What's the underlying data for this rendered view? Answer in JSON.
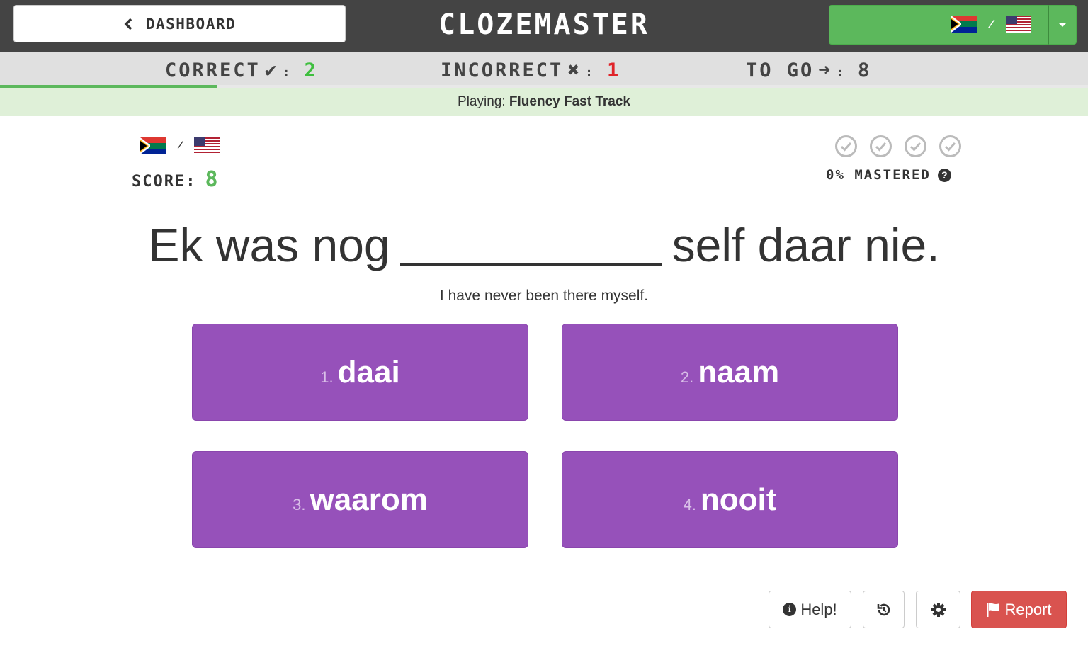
{
  "nav": {
    "dashboard_label": "DASHBOARD",
    "brand": "CLOZEMASTER",
    "language_pair": {
      "from_flag": "south-africa-flag",
      "to_flag": "usa-flag"
    }
  },
  "stats": {
    "correct_label": "CORRECT",
    "correct_value": "2",
    "incorrect_label": "INCORRECT",
    "incorrect_value": "1",
    "togo_label": "TO GO",
    "togo_value": "8",
    "progress_fraction": 0.2
  },
  "playing": {
    "prefix": "Playing:",
    "mode": "Fluency Fast Track"
  },
  "game": {
    "score_label": "SCORE:",
    "score_value": "8",
    "mastered_label": "0% MASTERED",
    "mastery_level": 0,
    "mastery_steps": 4
  },
  "question": {
    "before": "Ek was nog",
    "after": "self daar nie.",
    "translation": "I have never been there myself."
  },
  "choices": [
    {
      "num": "1.",
      "word": "daai"
    },
    {
      "num": "2.",
      "word": "naam"
    },
    {
      "num": "3.",
      "word": "waarom"
    },
    {
      "num": "4.",
      "word": "nooit"
    }
  ],
  "actions": {
    "help_label": "Help!",
    "report_label": "Report"
  },
  "colors": {
    "nav_bg": "#444444",
    "accent_green": "#5cb85c",
    "choice_purple": "#9651ba",
    "report_red": "#d9534f",
    "incorrect_red": "#e0242a"
  }
}
